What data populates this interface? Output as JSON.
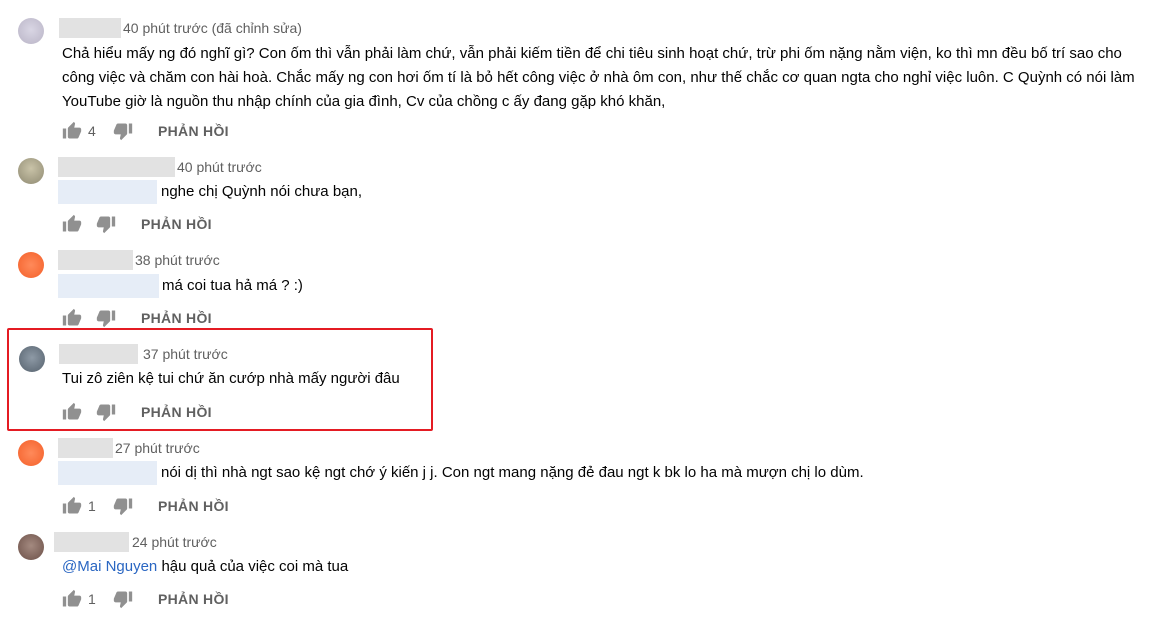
{
  "colors": {
    "highlight": "#e41b23",
    "link": "#2a66c2",
    "meta": "#606060"
  },
  "comments": [
    {
      "time": "40 phút trước (đã chỉnh sửa)",
      "text": "Chả hiểu mấy ng đó nghĩ gì? Con ốm thì vẫn phải làm chứ, vẫn phải kiếm tiền để chi tiêu sinh hoạt chứ, trừ phi ốm nặng nằm viện, ko thì mn đều bố trí sao cho công việc và chăm con hài hoà. Chắc mấy ng con hơi ốm tí là bỏ hết công việc ở nhà ôm con, như thế chắc cơ quan ngta cho nghỉ việc luôn. C Quỳnh có nói làm YouTube giờ là nguồn thu nhập chính của gia đình, Cv của chồng c ấy đang gặp khó khăn,",
      "likes": "4",
      "reply": "PHẢN HỒI"
    },
    {
      "time": "40 phút trước",
      "text": "nghe chị Quỳnh nói chưa bạn,",
      "likes": "",
      "reply": "PHẢN HỒI"
    },
    {
      "time": "38 phút trước",
      "text": "má coi tua hả má ? :)",
      "likes": "",
      "reply": "PHẢN HỒI"
    },
    {
      "time": "37 phút trước",
      "text": "Tui zô ziên kệ tui chứ ăn cướp nhà mấy người đâu",
      "likes": "",
      "reply": "PHẢN HỒI"
    },
    {
      "time": "27 phút trước",
      "text": "nói dị thì nhà ngt sao kệ ngt chớ ý kiến j j. Con ngt mang nặng đẻ đau ngt k bk lo ha mà mượn chị lo dùm.",
      "likes": "1",
      "reply": "PHẢN HỒI"
    },
    {
      "time": "24 phút trước",
      "mention": "@Mai Nguyen",
      "text": " hậu quả của việc coi mà tua",
      "likes": "1",
      "reply": "PHẢN HỒI"
    }
  ]
}
